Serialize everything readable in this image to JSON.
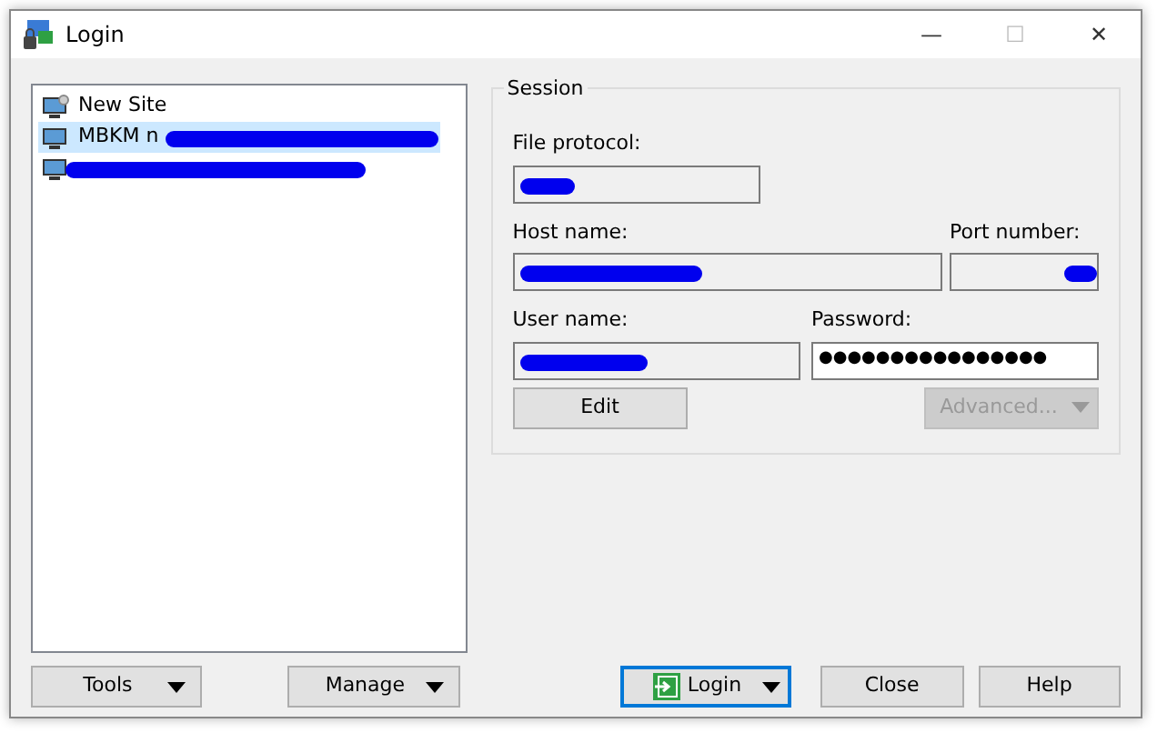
{
  "window": {
    "title": "Login",
    "controls": [
      "—",
      "☐",
      "✕"
    ]
  },
  "sites": [
    {
      "label": "New Site",
      "kind": "new",
      "selected": false,
      "redacted": false
    },
    {
      "label": "MBKM n",
      "kind": "site",
      "selected": true,
      "redacted": true
    },
    {
      "kind": "site",
      "selected": false,
      "redacted": true
    }
  ],
  "session": {
    "title": "Session",
    "fields": [
      {
        "label": "File protocol:",
        "redacted": true,
        "kind": "protocol"
      },
      {
        "label": "Host name:",
        "redacted": true,
        "kind": "host"
      },
      {
        "label": "Port number:",
        "redacted": true,
        "kind": "port"
      },
      {
        "label": "User name:",
        "redacted": true,
        "kind": "user"
      },
      {
        "label": "Password:",
        "value": "●●●●●●●●●●●●●●●●",
        "redacted": false,
        "kind": "password"
      }
    ],
    "edit_button": "Edit",
    "advanced_button": {
      "label": "Advanced...",
      "disabled": true
    }
  },
  "left_buttons": [
    "Tools",
    "Manage"
  ],
  "login_button": "Login",
  "buttons": [
    "Close",
    "Help"
  ]
}
